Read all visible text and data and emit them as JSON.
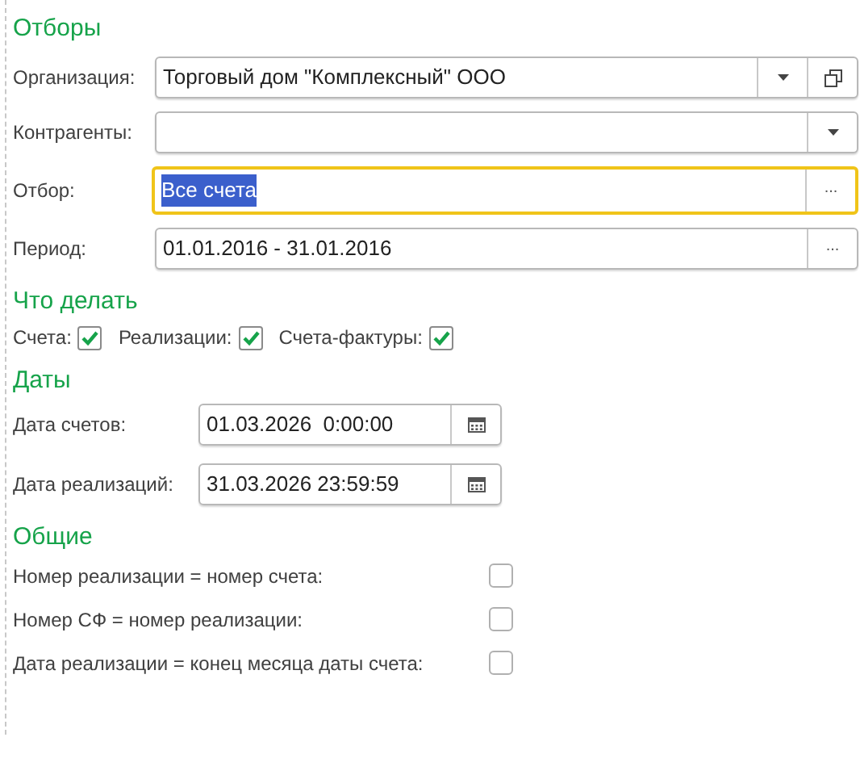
{
  "filters": {
    "title": "Отборы",
    "fields": [
      {
        "label": "Организация:",
        "value": "Торговый дом \"Комплексный\" ООО",
        "focused": false,
        "buttons": [
          {
            "kind": "dropdown"
          },
          {
            "kind": "open"
          }
        ]
      },
      {
        "label": "Контрагенты:",
        "focused": false,
        "buttons": [
          {
            "kind": "dropdown"
          }
        ]
      },
      {
        "label": "Отбор:",
        "value": "Все счета",
        "focused": true,
        "buttons": [
          {
            "kind": "more",
            "text": "..."
          }
        ]
      },
      {
        "label": "Период:",
        "value": "01.01.2016 - 31.01.2016",
        "focused": false,
        "buttons": [
          {
            "kind": "more",
            "text": "..."
          }
        ]
      }
    ]
  },
  "actions": {
    "title": "Что делать",
    "checks": [
      {
        "label": "Счета:",
        "checked": true
      },
      {
        "label": "Реализации:",
        "checked": true
      },
      {
        "label": "Счета-фактуры:",
        "checked": true
      }
    ]
  },
  "dates": {
    "title": "Даты",
    "fields": [
      {
        "label": "Дата счетов:",
        "value": "01.03.2026  0:00:00"
      },
      {
        "label": "Дата реализаций:",
        "value": "31.03.2026 23:59:59"
      }
    ]
  },
  "general": {
    "title": "Общие",
    "checks": [
      {
        "label": "Номер реализации = номер счета:",
        "checked": false
      },
      {
        "label": "Номер СФ = номер реализации:",
        "checked": false
      },
      {
        "label": "Дата реализации = конец месяца даты счета:",
        "checked": false
      }
    ]
  }
}
